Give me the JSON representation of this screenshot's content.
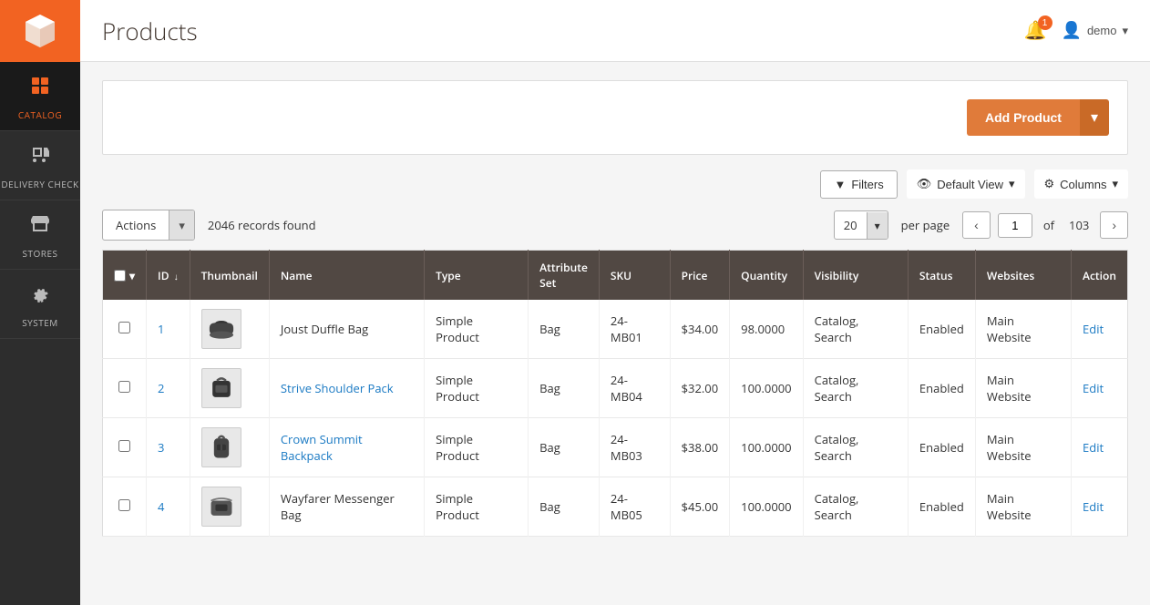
{
  "sidebar": {
    "logo_alt": "Magento",
    "items": [
      {
        "id": "catalog",
        "label": "CATALOG",
        "icon": "📦",
        "active": true
      },
      {
        "id": "delivery",
        "label": "DELIVERY CHECK",
        "icon": "🚚",
        "active": false
      },
      {
        "id": "stores",
        "label": "STORES",
        "icon": "🏪",
        "active": false
      },
      {
        "id": "system",
        "label": "SYSTEM",
        "icon": "⚙️",
        "active": false
      }
    ]
  },
  "header": {
    "title": "Products",
    "notification_count": "1",
    "user_label": "demo"
  },
  "toolbar": {
    "filters_label": "Filters",
    "default_view_label": "Default View",
    "columns_label": "Columns",
    "add_product_label": "Add Product"
  },
  "actions_bar": {
    "actions_label": "Actions",
    "records_found": "2046 records found",
    "per_page_value": "20",
    "per_page_label": "per page",
    "current_page": "1",
    "total_pages": "103"
  },
  "table": {
    "columns": [
      {
        "id": "checkbox",
        "label": ""
      },
      {
        "id": "id",
        "label": "ID"
      },
      {
        "id": "thumbnail",
        "label": "Thumbnail"
      },
      {
        "id": "name",
        "label": "Name"
      },
      {
        "id": "type",
        "label": "Type"
      },
      {
        "id": "attribute_set",
        "label": "Attribute Set"
      },
      {
        "id": "sku",
        "label": "SKU"
      },
      {
        "id": "price",
        "label": "Price"
      },
      {
        "id": "quantity",
        "label": "Quantity"
      },
      {
        "id": "visibility",
        "label": "Visibility"
      },
      {
        "id": "status",
        "label": "Status"
      },
      {
        "id": "websites",
        "label": "Websites"
      },
      {
        "id": "action",
        "label": "Action"
      }
    ],
    "rows": [
      {
        "id": "1",
        "name": "Joust Duffle Bag",
        "type": "Simple Product",
        "attribute_set": "Bag",
        "sku": "24-MB01",
        "price": "$34.00",
        "quantity": "98.0000",
        "visibility": "Catalog, Search",
        "status": "Enabled",
        "websites": "Main Website",
        "action": "Edit",
        "is_linked": false
      },
      {
        "id": "2",
        "name": "Strive Shoulder Pack",
        "type": "Simple Product",
        "attribute_set": "Bag",
        "sku": "24-MB04",
        "price": "$32.00",
        "quantity": "100.0000",
        "visibility": "Catalog, Search",
        "status": "Enabled",
        "websites": "Main Website",
        "action": "Edit",
        "is_linked": true
      },
      {
        "id": "3",
        "name": "Crown Summit Backpack",
        "type": "Simple Product",
        "attribute_set": "Bag",
        "sku": "24-MB03",
        "price": "$38.00",
        "quantity": "100.0000",
        "visibility": "Catalog, Search",
        "status": "Enabled",
        "websites": "Main Website",
        "action": "Edit",
        "is_linked": true
      },
      {
        "id": "4",
        "name": "Wayfarer Messenger Bag",
        "type": "Simple Product",
        "attribute_set": "Bag",
        "sku": "24-MB05",
        "price": "$45.00",
        "quantity": "100.0000",
        "visibility": "Catalog, Search",
        "status": "Enabled",
        "websites": "Main Website",
        "action": "Edit",
        "is_linked": false
      }
    ]
  }
}
